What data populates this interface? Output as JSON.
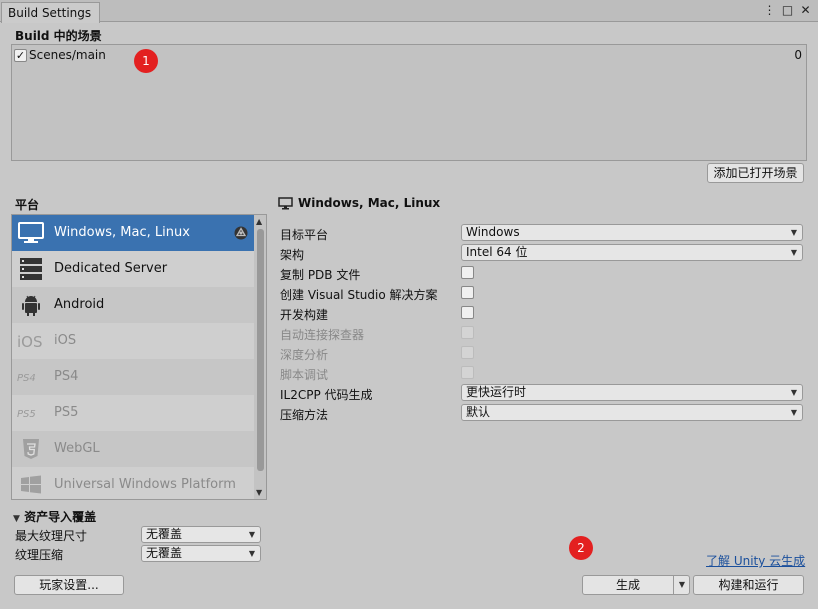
{
  "window": {
    "tab_title": "Build Settings",
    "controls": {
      "menu": "⋮",
      "maximize": "□",
      "close": "✕"
    }
  },
  "scenes": {
    "title": "Build 中的场景",
    "items": [
      {
        "checked": true,
        "name": "Scenes/main",
        "index": "0"
      }
    ],
    "add_open_button": "添加已打开场景"
  },
  "badges": {
    "first": "1",
    "second": "2"
  },
  "platforms": {
    "title": "平台",
    "items": [
      {
        "label": "Windows, Mac, Linux",
        "icon": "monitor-icon",
        "selected": true,
        "active_target": true
      },
      {
        "label": "Dedicated Server",
        "icon": "server-icon"
      },
      {
        "label": "Android",
        "icon": "android-icon"
      },
      {
        "label": "iOS",
        "icon": "ios-icon",
        "icon_text": "iOS",
        "inactive": true
      },
      {
        "label": "PS4",
        "icon": "ps4-icon",
        "icon_text": "PS4",
        "inactive": true
      },
      {
        "label": "PS5",
        "icon": "ps5-icon",
        "icon_text": "PS5",
        "inactive": true
      },
      {
        "label": "WebGL",
        "icon": "html5-icon",
        "inactive": true
      },
      {
        "label": "Universal Windows Platform",
        "icon": "windows-logo-icon",
        "inactive": true
      }
    ]
  },
  "platform_settings": {
    "title": "Windows, Mac, Linux",
    "target_platform": {
      "label": "目标平台",
      "value": "Windows"
    },
    "architecture": {
      "label": "架构",
      "value": "Intel 64 位"
    },
    "copy_pdb": {
      "label": "复制 PDB 文件"
    },
    "create_vs_solution": {
      "label": "创建 Visual Studio 解决方案"
    },
    "development_build": {
      "label": "开发构建"
    },
    "autoconnect_profiler": {
      "label": "自动连接探查器"
    },
    "deep_profiling": {
      "label": "深度分析"
    },
    "script_debugging": {
      "label": "脚本调试"
    },
    "il2cpp_codegen": {
      "label": "IL2CPP 代码生成",
      "value": "更快运行时"
    },
    "compression": {
      "label": "压缩方法",
      "value": "默认"
    }
  },
  "asset_import": {
    "title": "资产导入覆盖",
    "max_texture_size": {
      "label": "最大纹理尺寸",
      "value": "无覆盖"
    },
    "texture_compression": {
      "label": "纹理压缩",
      "value": "无覆盖"
    }
  },
  "footer": {
    "player_settings": "玩家设置...",
    "cloud_link": "了解 Unity 云生成",
    "build": "生成",
    "build_and_run": "构建和运行"
  }
}
